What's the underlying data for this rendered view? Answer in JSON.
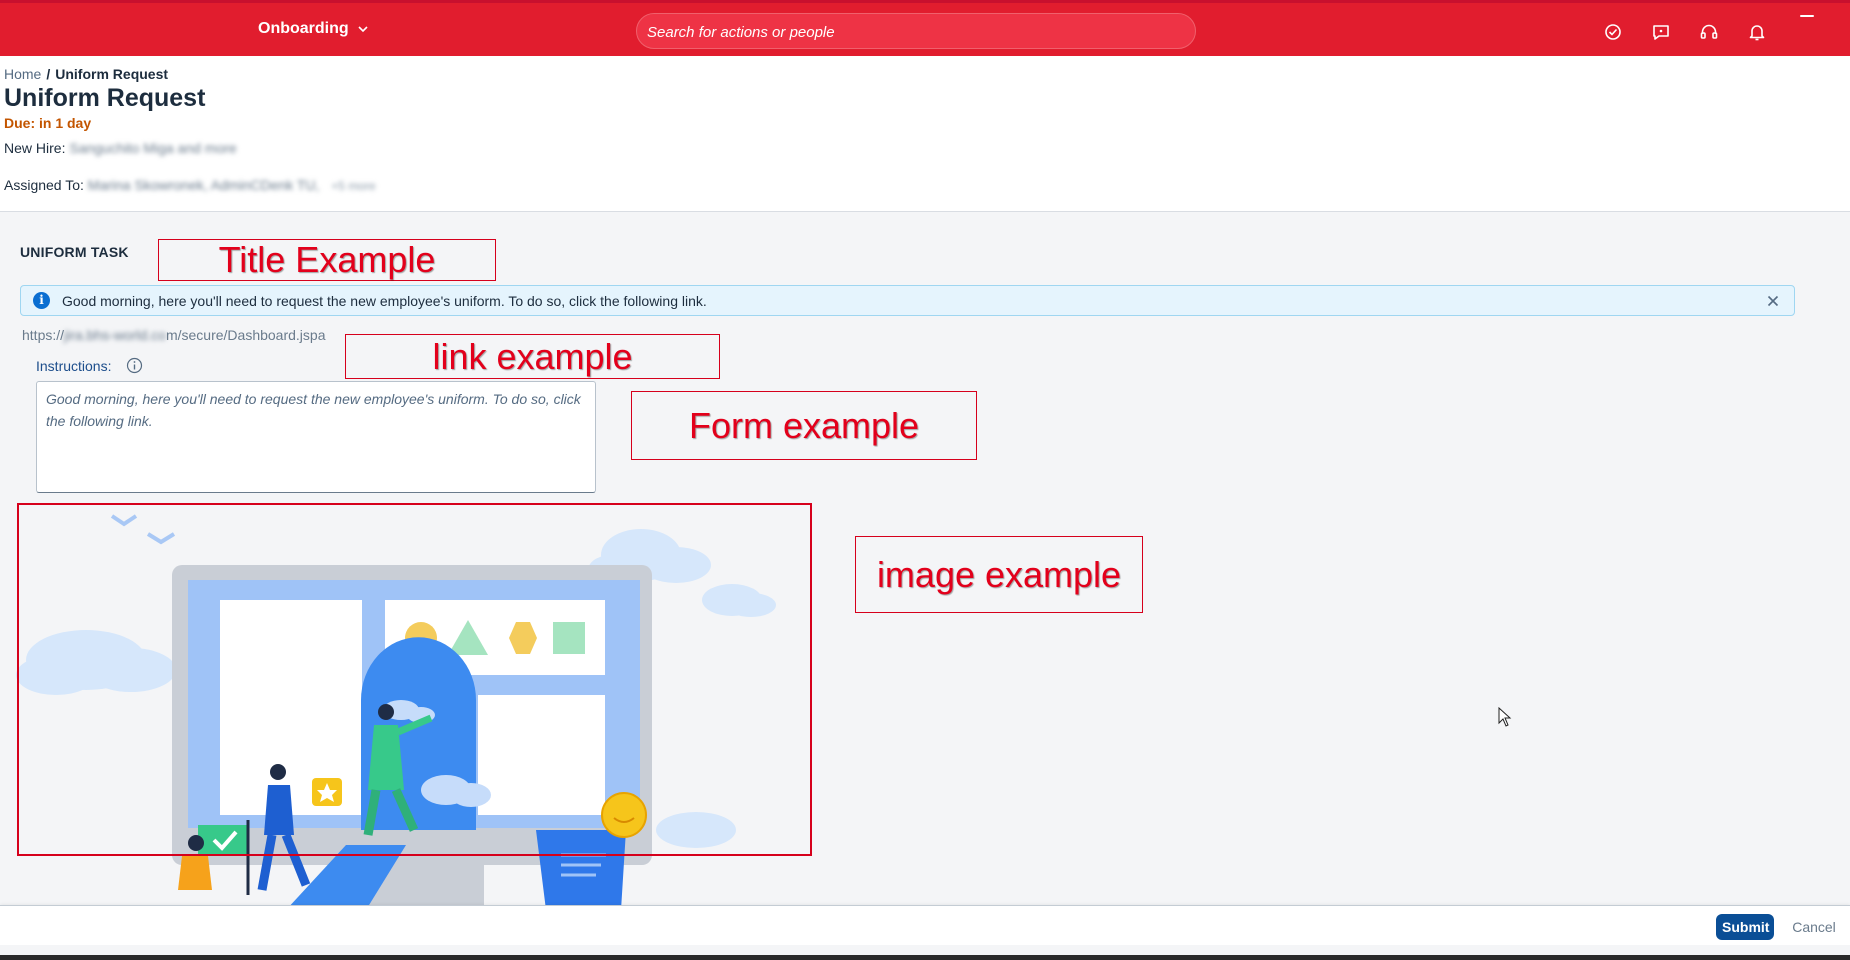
{
  "shell": {
    "app_title": "Onboarding",
    "search_placeholder": "Search for actions or people",
    "icons": [
      "check-circle-icon",
      "feedback-icon",
      "headset-icon",
      "bell-icon"
    ],
    "brand_color": "#e11d2e"
  },
  "header": {
    "breadcrumb": {
      "home": "Home",
      "separator": "/",
      "current": "Uniform Request"
    },
    "title": "Uniform Request",
    "due": "Due: in 1 day",
    "new_hire_label": "New Hire:",
    "new_hire_value": "Sanguchito Miga and more",
    "assigned_label": "Assigned To:",
    "assigned_value": "Marina Skowronek, AdminCDenk TU,",
    "assigned_more": "+5 more"
  },
  "task": {
    "section_label": "UNIFORM TASK",
    "info_message": "Good morning, here you'll need to request the new employee's uniform. To do so, click the following link.",
    "link_prefix": "https://",
    "link_hidden": "jira.bhs-world.co",
    "link_suffix": "m/secure/Dashboard.jspa",
    "instructions_label": "Instructions:",
    "instructions_text": "Good morning, here you'll need to request the new employee's uniform. To do so, click the following link."
  },
  "annotations": {
    "title": "Title Example",
    "link": "link example",
    "form": "Form example",
    "image": "image example",
    "color": "#e3001b"
  },
  "footer": {
    "submit": "Submit",
    "cancel": "Cancel"
  }
}
